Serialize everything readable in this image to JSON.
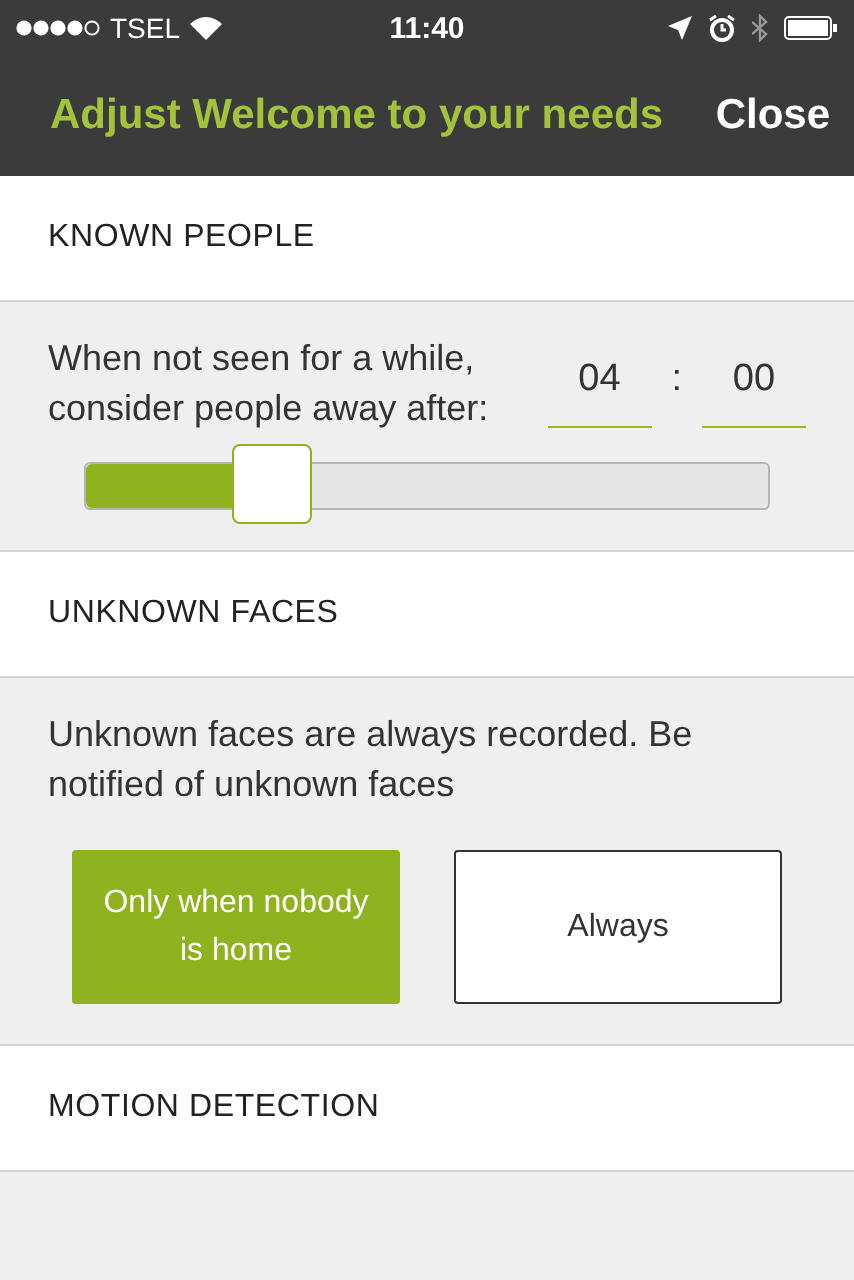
{
  "status_bar": {
    "carrier": "TSEL",
    "time": "11:40"
  },
  "header": {
    "title": "Adjust Welcome to your needs",
    "close": "Close"
  },
  "sections": [
    {
      "title": "KNOWN PEOPLE",
      "kind": "away",
      "text": "When not seen for a while, consider people away after:",
      "hours": "04",
      "separator": ":",
      "minutes": "00",
      "level": 0.27
    },
    {
      "title": "UNKNOWN FACES",
      "kind": "choice",
      "text": "Unknown faces are always recorded. Be notified of unknown faces",
      "options": [
        {
          "label": "Only when nobody is home",
          "selected": true
        },
        {
          "label": "Always",
          "selected": false
        }
      ]
    },
    {
      "title": "MOTION DETECTION",
      "kind": "empty"
    }
  ]
}
